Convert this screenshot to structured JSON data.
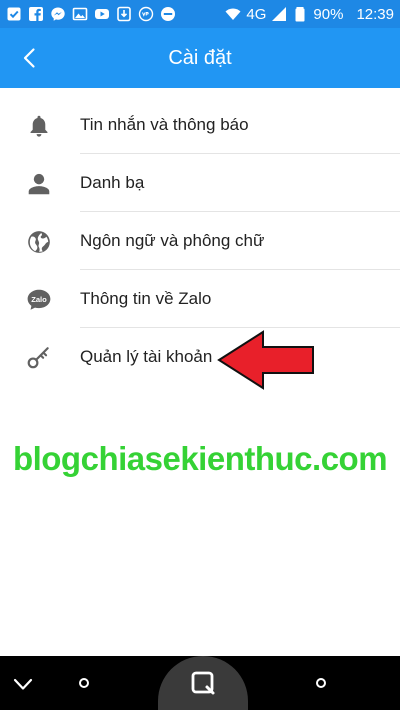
{
  "status_bar": {
    "network": "4G",
    "battery": "90%",
    "time": "12:39",
    "icons": [
      "checkbox-icon",
      "facebook-icon",
      "messenger-icon",
      "image-icon",
      "youtube-icon",
      "download-icon",
      "vpn-icon",
      "dnd-icon",
      "wifi-icon",
      "signal-icon",
      "battery-icon"
    ]
  },
  "app_bar": {
    "title": "Cài đặt",
    "back_icon": "chevron-left-icon"
  },
  "settings": {
    "items": [
      {
        "label": "Tin nhắn và thông báo",
        "icon": "bell-icon"
      },
      {
        "label": "Danh bạ",
        "icon": "person-icon"
      },
      {
        "label": "Ngôn ngữ và phông chữ",
        "icon": "globe-icon"
      },
      {
        "label": "Thông tin về Zalo",
        "icon": "zalo-chat-icon"
      },
      {
        "label": "Quản lý tài khoản",
        "icon": "key-icon"
      }
    ]
  },
  "annotation": {
    "arrow_color": "#e8202a",
    "arrow_direction": "left"
  },
  "watermark": {
    "text": "blogchiasekienthuc.com",
    "color": "#35d235"
  },
  "nav_bar": {
    "icons": [
      "nav-back-icon",
      "nav-dot-icon",
      "nav-home-icon",
      "nav-dot-icon"
    ]
  },
  "colors": {
    "status_bar": "#1e88e5",
    "app_bar": "#2196f3",
    "icon_gray": "#616161"
  }
}
